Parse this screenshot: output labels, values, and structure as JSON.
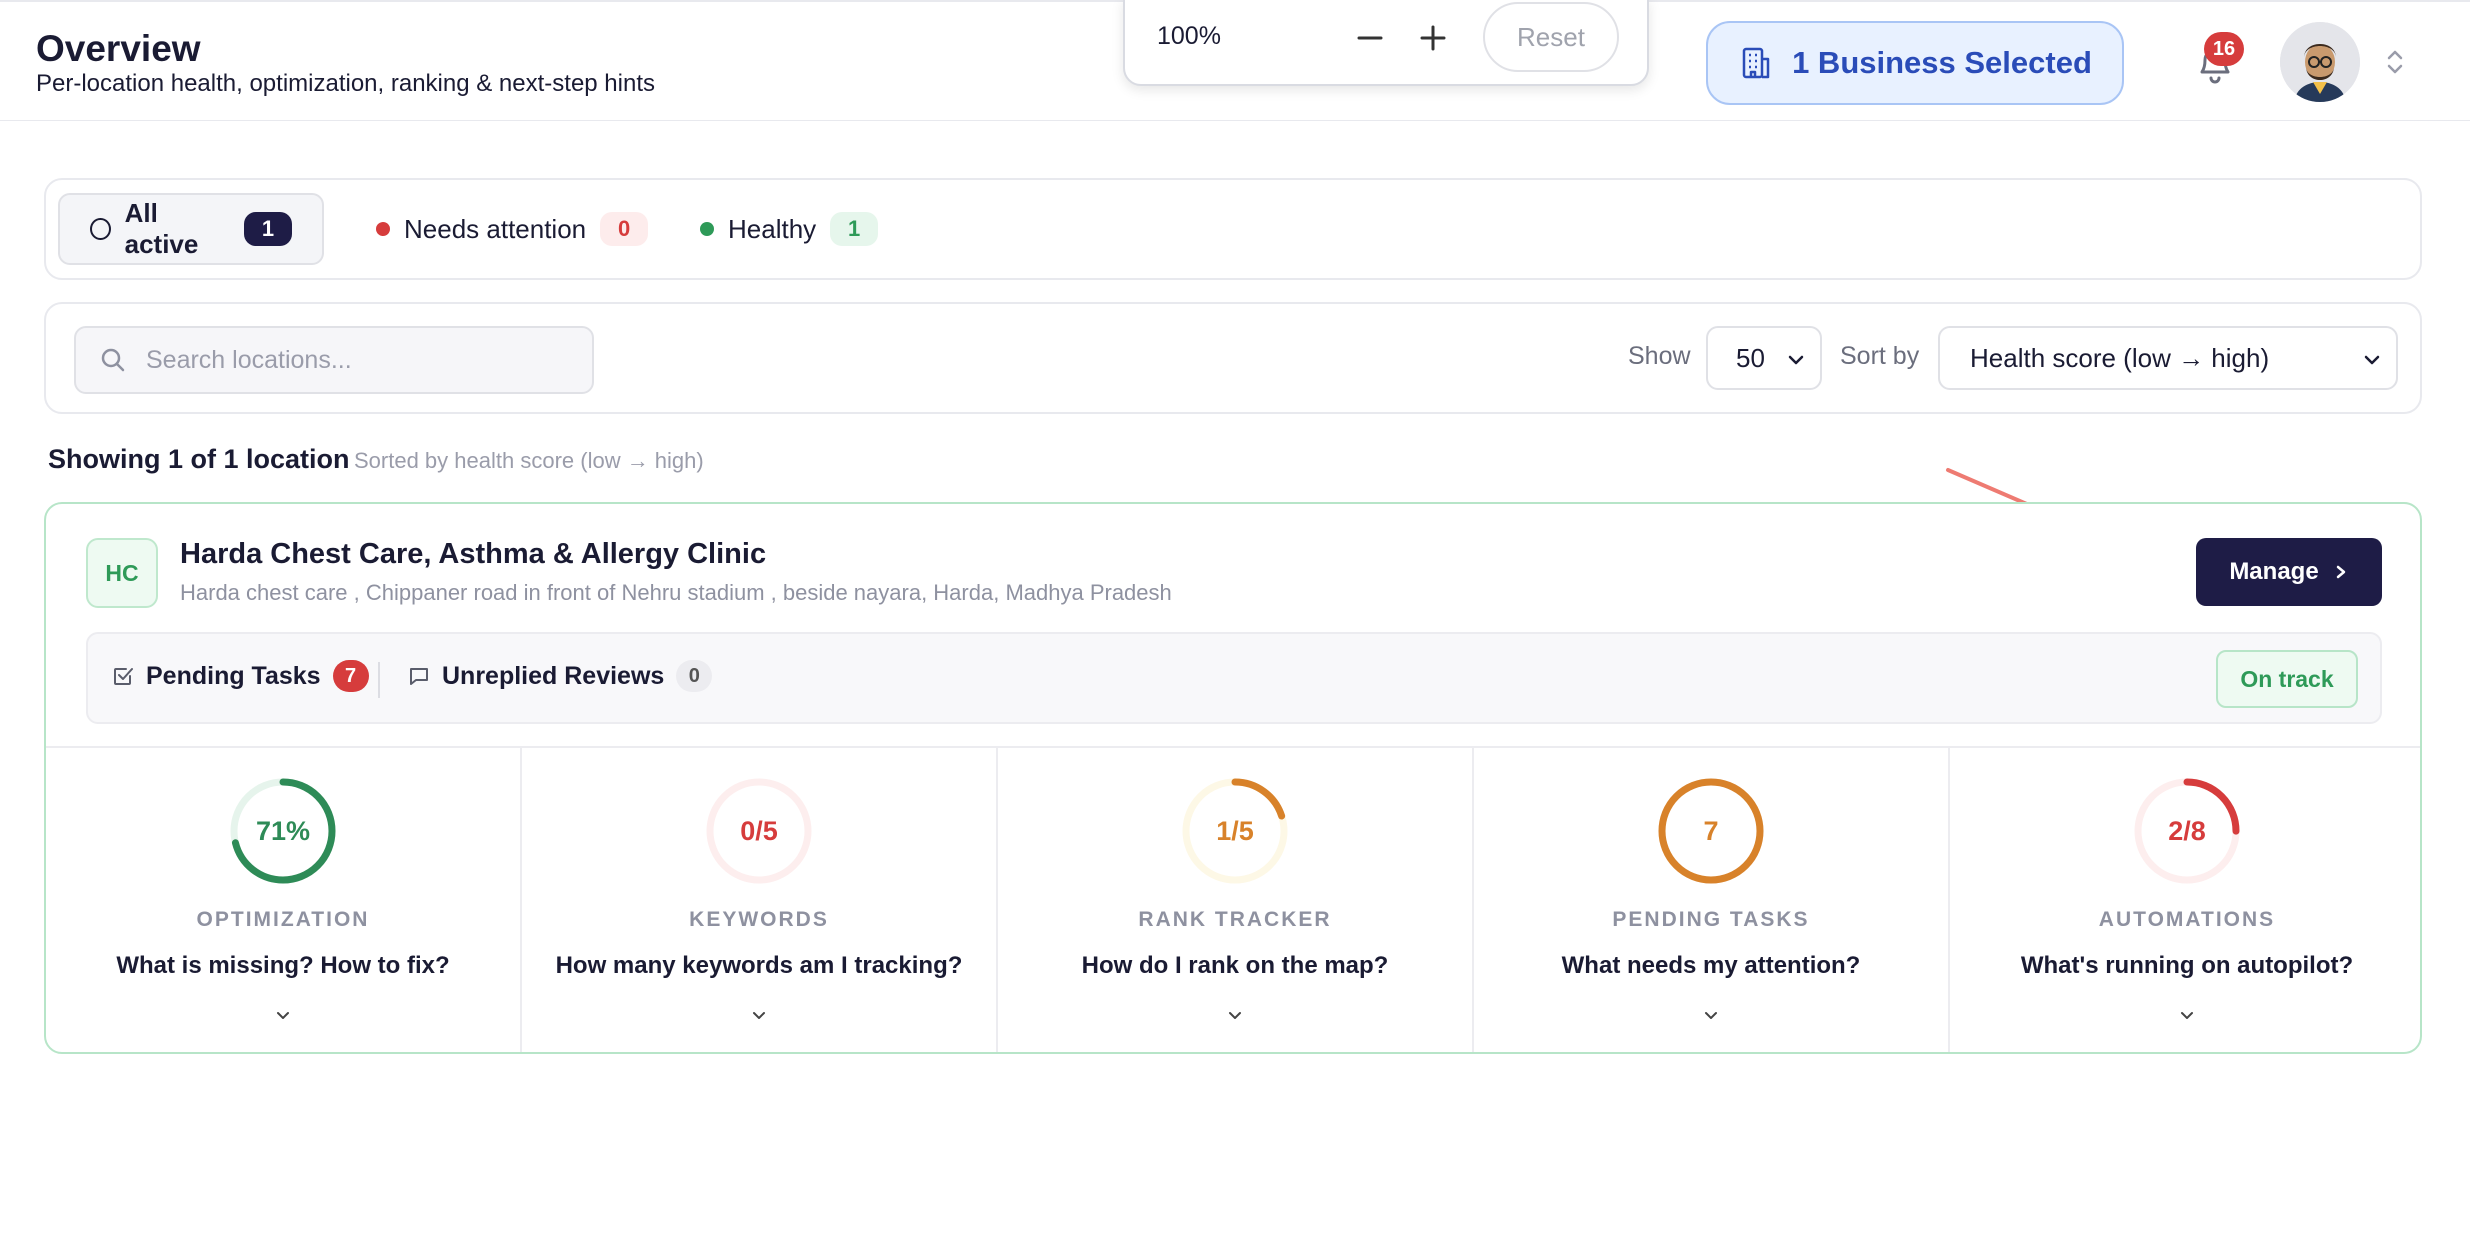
{
  "header": {
    "title": "Overview",
    "subtitle": "Per-location health, optimization, ranking & next-step hints"
  },
  "zoom": {
    "value": "100%",
    "minus": "−",
    "plus": "+",
    "reset": "Reset"
  },
  "business_button": {
    "label": "1 Business Selected",
    "icon": "building-icon"
  },
  "notifications": {
    "count": "16",
    "icon": "bell-icon"
  },
  "filters": [
    {
      "label": "All active",
      "count": "1",
      "active": true
    },
    {
      "label": "Needs attention",
      "count": "0",
      "color": "#d63c3c"
    },
    {
      "label": "Healthy",
      "count": "1",
      "color": "#2e9a58"
    }
  ],
  "search": {
    "placeholder": "Search locations..."
  },
  "show": {
    "label": "Show",
    "value": "50"
  },
  "sort": {
    "label": "Sort by",
    "value": "Health score (low → high)"
  },
  "results": {
    "showing": "Showing 1 of 1 location",
    "sorted_hint": "Sorted by health score (low → high)"
  },
  "location": {
    "initials": "HC",
    "name": "Harda Chest Care, Asthma & Allergy Clinic",
    "address": "Harda chest care , Chippaner road in front of Nehru stadium , beside nayara, Harda, Madhya Pradesh",
    "manage_label": "Manage",
    "pending_tasks_label": "Pending Tasks",
    "pending_tasks_count": "7",
    "unreplied_reviews_label": "Unreplied Reviews",
    "unreplied_reviews_count": "0",
    "status": "On track"
  },
  "metrics": [
    {
      "value": "71%",
      "label": "OPTIMIZATION",
      "question": "What is missing? How to fix?",
      "progress": 0.71,
      "color": "#2e8b57",
      "track": "#e6f4ec"
    },
    {
      "value": "0/5",
      "label": "KEYWORDS",
      "question": "How many keywords am I tracking?",
      "progress": 0.0,
      "color": "#d63c3c",
      "track": "#fdeeee"
    },
    {
      "value": "1/5",
      "label": "RANK TRACKER",
      "question": "How do I rank on the map?",
      "progress": 0.2,
      "color": "#d8822a",
      "track": "#fdf8e6"
    },
    {
      "value": "7",
      "label": "PENDING TASKS",
      "question": "What needs my attention?",
      "progress": 1.0,
      "color": "#d8822a",
      "track": "#fbeedd"
    },
    {
      "value": "2/8",
      "label": "AUTOMATIONS",
      "question": "What's running on autopilot?",
      "progress": 0.25,
      "color": "#d63c3c",
      "track": "#fdeeee"
    }
  ]
}
